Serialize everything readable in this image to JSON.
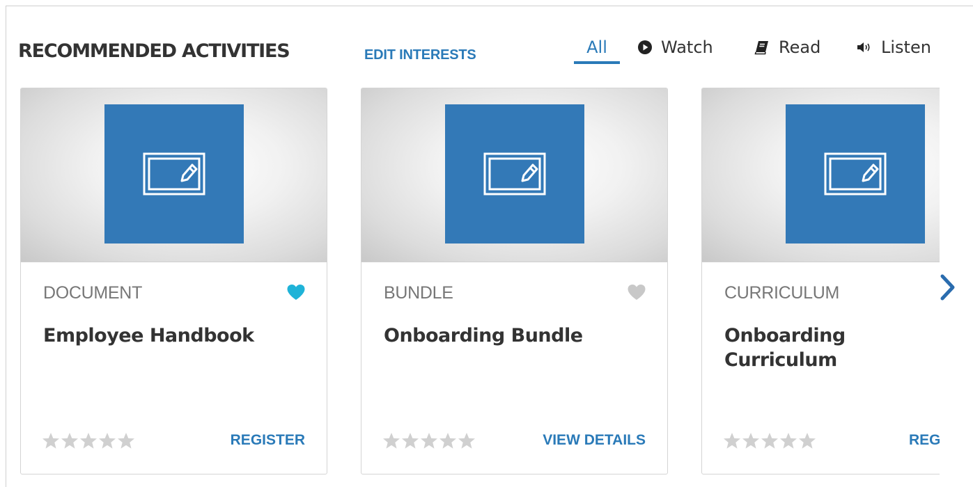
{
  "header": {
    "title": "RECOMMENDED ACTIVITIES",
    "edit_link": "EDIT INTERESTS"
  },
  "filters": [
    {
      "label": "All",
      "icon": "",
      "active": true
    },
    {
      "label": "Watch",
      "icon": "play-circle-icon",
      "active": false
    },
    {
      "label": "Read",
      "icon": "book-icon",
      "active": false
    },
    {
      "label": "Listen",
      "icon": "speaker-icon",
      "active": false
    }
  ],
  "cards": [
    {
      "type": "DOCUMENT",
      "title": "Employee Handbook",
      "action": "REGISTER",
      "favorited": true,
      "rating": 0,
      "thumbnail_icon": "edit-form-icon"
    },
    {
      "type": "BUNDLE",
      "title": "Onboarding Bundle",
      "action": "VIEW DETAILS",
      "favorited": false,
      "rating": 0,
      "thumbnail_icon": "edit-form-icon"
    },
    {
      "type": "CURRICULUM",
      "title": "Onboarding Curriculum",
      "action": "REGISTER",
      "favorited": false,
      "rating": 0,
      "thumbnail_icon": "edit-form-icon"
    }
  ],
  "colors": {
    "accent": "#2a7ab8",
    "tile": "#3379b7",
    "favorite_active": "#1fb3d8",
    "favorite_inactive": "#c8c8c8",
    "star_empty": "#d0d0d0"
  }
}
